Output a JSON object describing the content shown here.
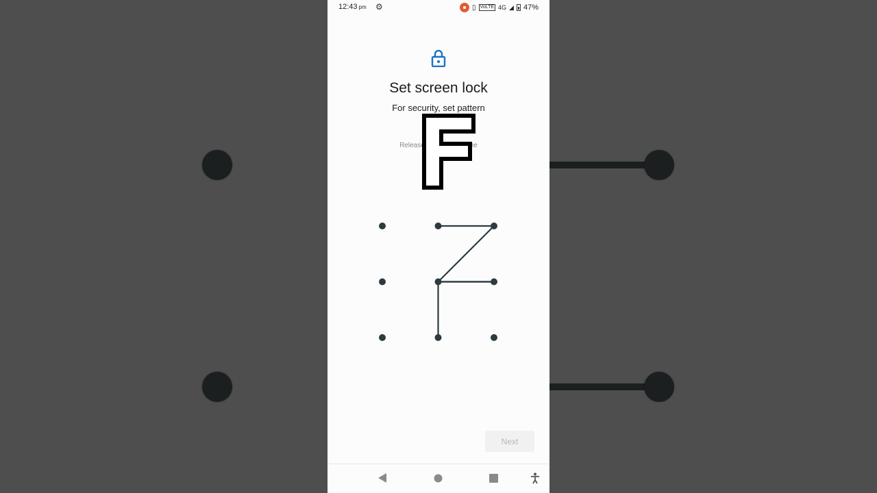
{
  "status_bar": {
    "time": "12:43",
    "ampm": "pm",
    "network": "4G",
    "volte": "VoLTE",
    "battery": "47%"
  },
  "screen": {
    "title": "Set screen lock",
    "subtitle": "For security, set pattern",
    "hint_left": "Release",
    "hint_right": "ne",
    "overlay_letter": "F"
  },
  "pattern": {
    "grid": 3,
    "connected_path": [
      1,
      2,
      4,
      5,
      4,
      7
    ]
  },
  "actions": {
    "next_label": "Next"
  },
  "colors": {
    "accent": "#1a73c8",
    "pattern": "#2d3b40",
    "background": "#4e4e4e"
  }
}
